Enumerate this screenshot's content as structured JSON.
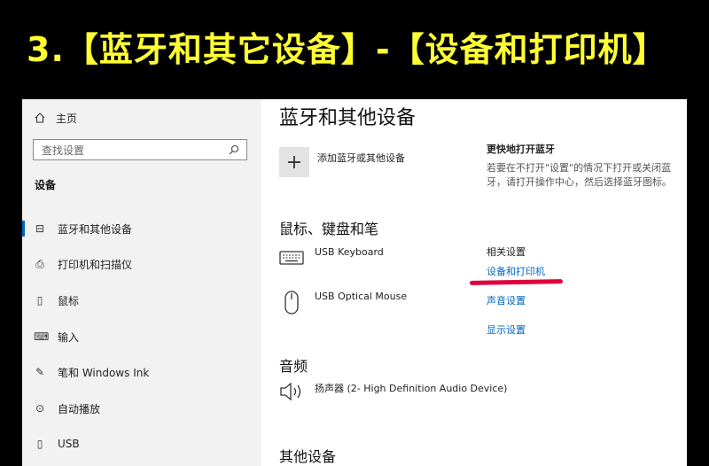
{
  "banner": {
    "text": "3.【蓝牙和其它设备】-【设备和打印机】"
  },
  "sidebar": {
    "home_label": "主页",
    "search_placeholder": "查找设置",
    "section_title": "设备",
    "items": [
      {
        "label": "蓝牙和其他设备",
        "icon": "bluetooth-devices-icon"
      },
      {
        "label": "打印机和扫描仪",
        "icon": "printer-icon"
      },
      {
        "label": "鼠标",
        "icon": "mouse-icon"
      },
      {
        "label": "输入",
        "icon": "keyboard-icon"
      },
      {
        "label": "笔和 Windows Ink",
        "icon": "pen-icon"
      },
      {
        "label": "自动播放",
        "icon": "autoplay-icon"
      },
      {
        "label": "USB",
        "icon": "usb-icon"
      }
    ]
  },
  "main": {
    "title": "蓝牙和其他设备",
    "add_device_label": "添加蓝牙或其他设备",
    "mkp_heading": "鼠标、键盘和笔",
    "devices": [
      {
        "name": "USB Keyboard",
        "icon": "keyboard-icon"
      },
      {
        "name": "USB Optical Mouse",
        "icon": "mouse-icon"
      }
    ],
    "audio_heading": "音频",
    "audio_device": "扬声器 (2- High Definition Audio Device)",
    "other_heading": "其他设备"
  },
  "right": {
    "quick_title": "更快地打开蓝牙",
    "quick_desc": "若要在不打开\"设置\"的情况下打开或关闭蓝牙，请打开操作中心，然后选择蓝牙图标。",
    "related_title": "相关设置",
    "links": [
      "设备和打印机",
      "声音设置",
      "显示设置"
    ]
  },
  "colors": {
    "banner_text": "#ffff33",
    "accent": "#0067c0",
    "annotation": "#e0003a"
  }
}
